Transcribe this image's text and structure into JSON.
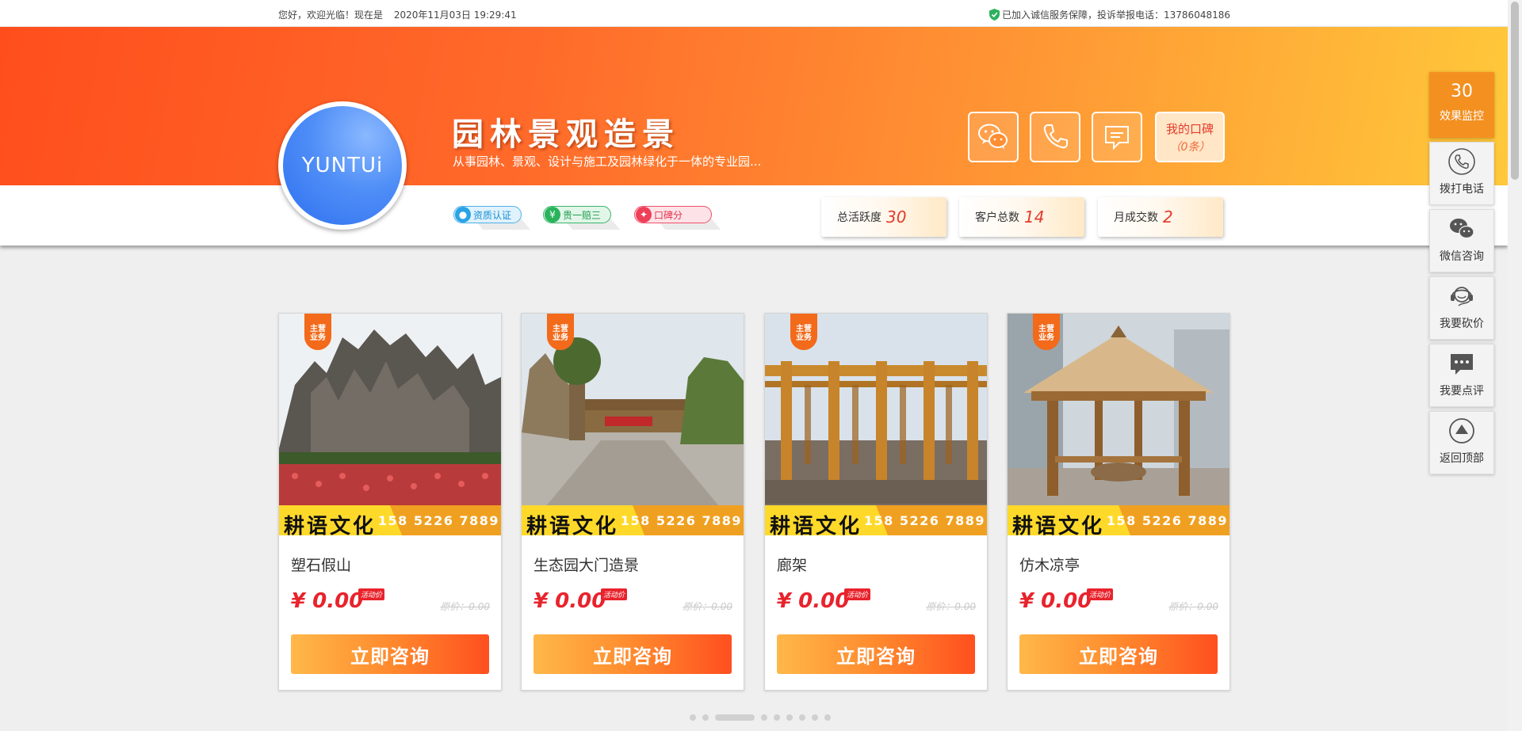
{
  "topbar": {
    "greeting": "您好，欢迎光临！现在是",
    "datetime": "2020年11月03日 19:29:41",
    "assurance": "已加入诚信服务保障，投诉举报电话：13786048186"
  },
  "header": {
    "logo_text": "YUNTUi",
    "title": "园林景观造景",
    "description": "从事园林、景观、设计与施工及园林绿化于一体的专业园...",
    "badges": [
      "资质认证",
      "贵一赔三",
      "口碑分"
    ],
    "reputation": {
      "label": "我的口碑",
      "count": "（0条）"
    },
    "stats": [
      {
        "label": "总活跃度",
        "value": "30"
      },
      {
        "label": "客户总数",
        "value": "14"
      },
      {
        "label": "月成交数",
        "value": "2"
      }
    ]
  },
  "products": [
    {
      "tag_line1": "主营",
      "tag_line2": "业务",
      "brand": "耕语文化",
      "phone": "158 5226 7889",
      "name": "塑石假山",
      "price": "¥ 0.00",
      "promo": "活动价",
      "original": "原价：0.00",
      "button": "立即咨询"
    },
    {
      "tag_line1": "主营",
      "tag_line2": "业务",
      "brand": "耕语文化",
      "phone": "158 5226 7889",
      "name": "生态园大门造景",
      "price": "¥ 0.00",
      "promo": "活动价",
      "original": "原价：0.00",
      "button": "立即咨询"
    },
    {
      "tag_line1": "主营",
      "tag_line2": "业务",
      "brand": "耕语文化",
      "phone": "158 5226 7889",
      "name": "廊架",
      "price": "¥ 0.00",
      "promo": "活动价",
      "original": "原价：0.00",
      "button": "立即咨询"
    },
    {
      "tag_line1": "主营",
      "tag_line2": "业务",
      "brand": "耕语文化",
      "phone": "158 5226 7889",
      "name": "仿木凉亭",
      "price": "¥ 0.00",
      "promo": "活动价",
      "original": "原价：0.00",
      "button": "立即咨询"
    }
  ],
  "carousel": {
    "dot_count": 9,
    "active_index": 2
  },
  "float_panel": {
    "monitor": {
      "value": "30",
      "label": "效果监控"
    },
    "items": [
      {
        "icon": "phone-icon",
        "label": "拨打电话"
      },
      {
        "icon": "wechat-icon",
        "label": "微信咨询"
      },
      {
        "icon": "headset-icon",
        "label": "我要砍价"
      },
      {
        "icon": "comment-icon",
        "label": "我要点评"
      },
      {
        "icon": "back-to-top-icon",
        "label": "返回顶部"
      }
    ]
  },
  "colors": {
    "brand_orange": "#ff6a2a",
    "price_red": "#e8232c",
    "float_orange": "#f39020"
  }
}
